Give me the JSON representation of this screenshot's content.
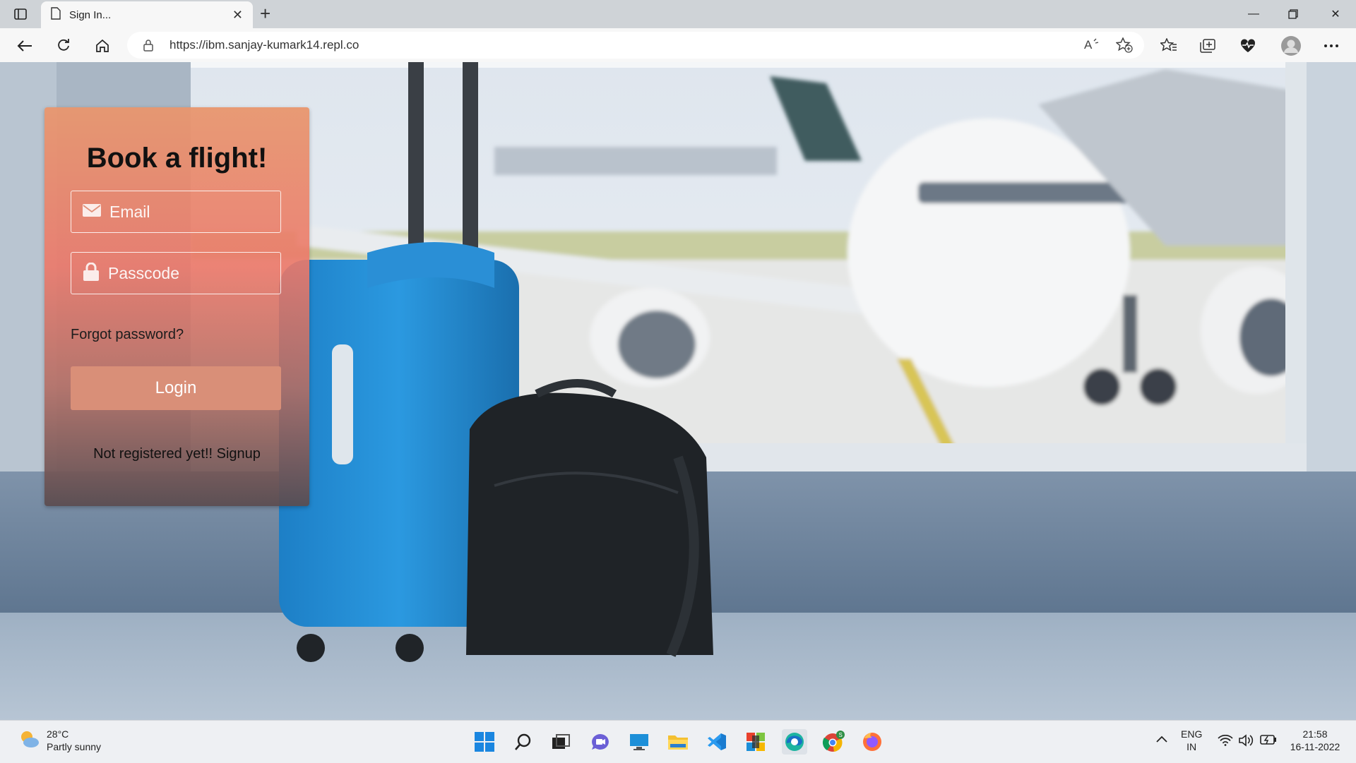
{
  "browser": {
    "tab_title": "Sign In...",
    "url": "https://ibm.sanjay-kumark14.repl.co"
  },
  "login_card": {
    "heading": "Book a flight!",
    "email_placeholder": "Email",
    "passcode_placeholder": "Passcode",
    "forgot_password": "Forgot password?",
    "login_label": "Login",
    "signup_text": "Not registered yet!! Signup"
  },
  "taskbar": {
    "weather_temp": "28°C",
    "weather_desc": "Partly sunny",
    "language": "ENG",
    "region": "IN",
    "time": "21:58",
    "date": "16-11-2022",
    "icons": [
      "start-icon",
      "search-icon",
      "task-view-icon",
      "chat-icon",
      "desktop-icon",
      "file-explorer-icon",
      "vscode-icon",
      "store-icon",
      "edge-icon",
      "chrome-icon",
      "firefox-icon"
    ]
  },
  "colors": {
    "card_top": "#e8966e",
    "login_button": "#d98f78",
    "chrome_bg": "#cfd3d7"
  }
}
